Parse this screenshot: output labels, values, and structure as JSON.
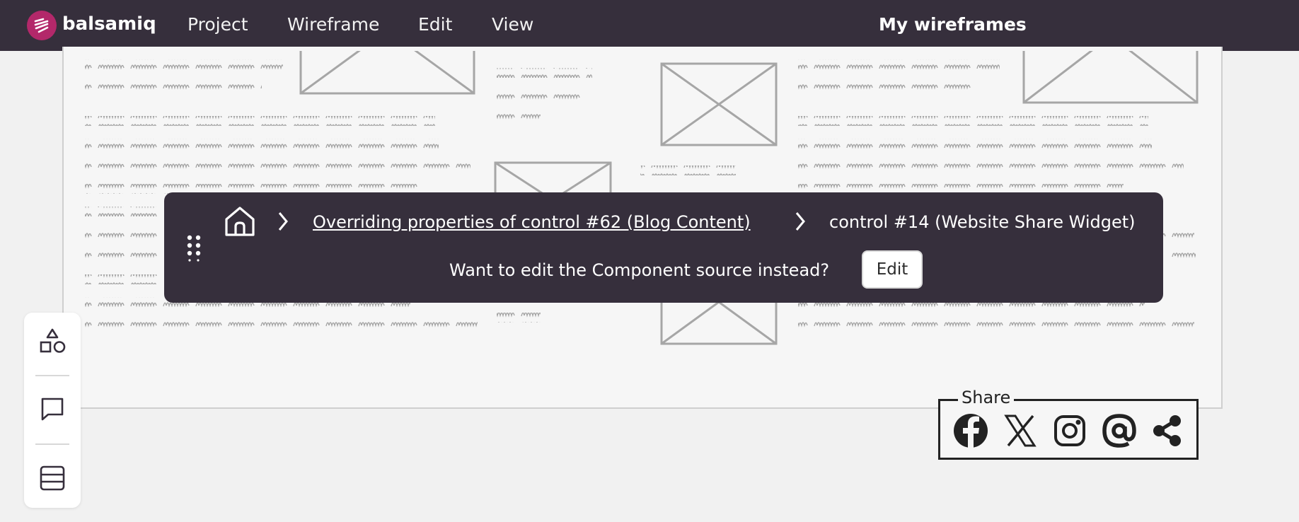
{
  "app": {
    "brand": "balsamiq",
    "title": "My wireframes"
  },
  "menu": {
    "project": "Project",
    "wireframe": "Wireframe",
    "edit": "Edit",
    "view": "View"
  },
  "breadcrumb": {
    "parent": "Overriding properties of control #62 (Blog Content)",
    "current": "control #14 (Website Share Widget)"
  },
  "prompt": {
    "question": "Want to edit the Component source instead?",
    "edit_label": "Edit"
  },
  "share_widget": {
    "label": "Share",
    "icons": [
      "facebook-icon",
      "x-icon",
      "instagram-icon",
      "at-icon",
      "share-icon"
    ]
  },
  "toolbar": {
    "icons": [
      "shapes-icon",
      "comment-icon",
      "layers-icon"
    ]
  },
  "colors": {
    "topbar": "#362f3c",
    "logo": "#b3286a",
    "overlay": "#362f3c"
  }
}
